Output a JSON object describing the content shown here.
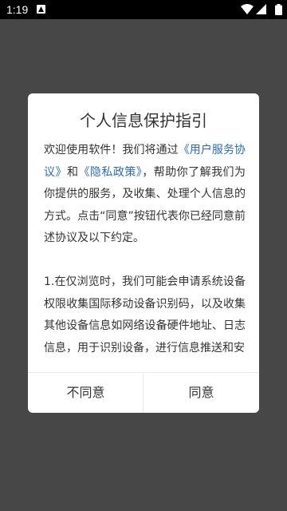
{
  "status_bar": {
    "time": "1:19",
    "icons": [
      "app-notification-icon",
      "wifi-icon",
      "cellular-signal-icon",
      "battery-icon"
    ]
  },
  "dialog": {
    "title": "个人信息保护指引",
    "paragraph1": {
      "part1": "欢迎使用软件！我们将通过",
      "link1": "《用户服务协议》",
      "part2": "和",
      "link2": "《隐私政策》",
      "part3": "，帮助你了解我们为你提供的服务，及收集、处理个人信息的方式。点击“同意”按钮代表你已经同意前述协议及以下约定。"
    },
    "paragraph2": "1.在仅浏览时，我们可能会申请系统设备权限收集国际移动设备识别码，以及收集其他设备信息如网络设备硬件地址、日志信息，用于识别设备，进行信息推送和安",
    "disagree_label": "不同意",
    "agree_label": "同意"
  },
  "colors": {
    "backdrop": "#474747",
    "link": "#2a6bb8",
    "text": "#333333"
  }
}
